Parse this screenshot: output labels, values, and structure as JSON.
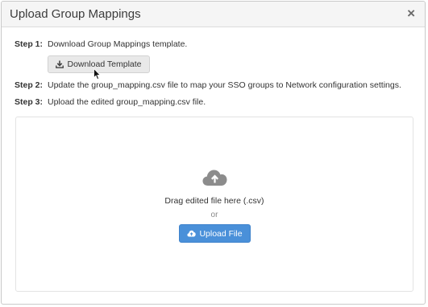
{
  "dialog": {
    "title": "Upload Group Mappings",
    "close_glyph": "×"
  },
  "steps": [
    {
      "label": "Step 1:",
      "text": "Download Group Mappings template."
    },
    {
      "label": "Step 2:",
      "text": "Update the group_mapping.csv file to map your SSO groups to Network configuration settings."
    },
    {
      "label": "Step 3:",
      "text": "Upload the edited group_mapping.csv file."
    }
  ],
  "download_button": {
    "label": "Download Template",
    "icon": "download-icon"
  },
  "dropzone": {
    "icon": "cloud-upload-icon",
    "drag_text": "Drag edited file here (.csv)",
    "or_text": "or",
    "upload_button": {
      "label": "Upload File",
      "icon": "cloud-upload-icon"
    }
  },
  "colors": {
    "primary": "#4a90d9",
    "header_bg": "#f5f5f5",
    "icon_gray": "#8c8c8c"
  }
}
